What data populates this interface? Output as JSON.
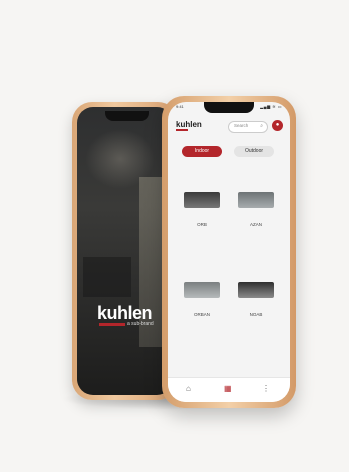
{
  "colors": {
    "accent": "#b3262b",
    "frame": "#e9bd8f"
  },
  "back_phone": {
    "logo": "kuhlen",
    "logo_sub": "a sub-brand"
  },
  "front_phone": {
    "status": {
      "time": "9:41",
      "signal": "▂▄▆ ≋ ▭"
    },
    "header": {
      "brand": "kuhlen",
      "search_placeholder": "Search",
      "search_icon": "search-icon",
      "avatar_icon": "user-icon"
    },
    "tabs": [
      {
        "label": "Indoor",
        "selected": true
      },
      {
        "label": "Outdoor",
        "selected": false
      }
    ],
    "products": [
      {
        "name": "ORB"
      },
      {
        "name": "AZAN"
      },
      {
        "name": "ORBAN"
      },
      {
        "name": "NOAB"
      }
    ],
    "bottom_nav": [
      {
        "icon": "home-icon",
        "glyph": "⌂"
      },
      {
        "icon": "grid-icon",
        "glyph": "▦"
      },
      {
        "icon": "menu-icon",
        "glyph": "⋮"
      }
    ]
  }
}
